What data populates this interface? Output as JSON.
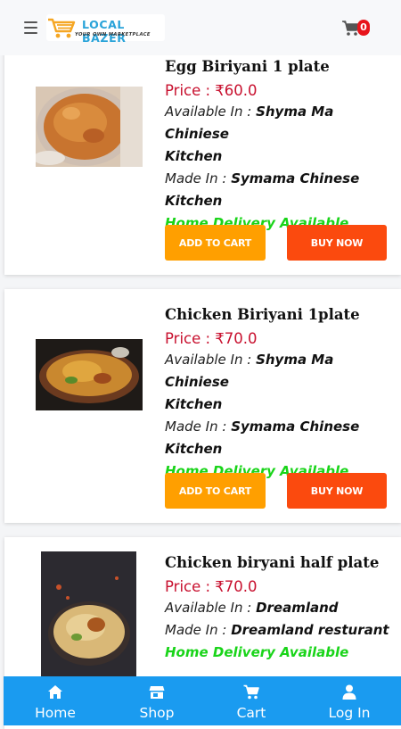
{
  "header": {
    "logo_text": "LOCAL BAZER",
    "logo_tagline": "YOUR OWN MARKETPLACE",
    "cart_count": "0"
  },
  "labels": {
    "available_in": "Available In :",
    "made_in": "Made In :"
  },
  "products": [
    {
      "title": "Egg Biriyani 1 plate",
      "price": "Price : ₹60.0",
      "available_line1": "Shyma Ma Chiniese",
      "available_line2": "Kitchen",
      "made_line1": "Symama Chinese",
      "made_line2": "Kitchen",
      "delivery": "Home Delivery Available",
      "add_to_cart": "ADD TO CART",
      "buy_now": "BUY NOW"
    },
    {
      "title": "Chicken Biriyani 1plate",
      "price": "Price : ₹70.0",
      "available_line1": "Shyma Ma Chiniese",
      "available_line2": "Kitchen",
      "made_line1": "Symama Chinese",
      "made_line2": "Kitchen",
      "delivery": "Home Delivery Available",
      "add_to_cart": "ADD TO CART",
      "buy_now": "BUY NOW"
    },
    {
      "title": "Chicken biryani half plate",
      "price": "Price : ₹70.0",
      "available_line1": "Dreamland",
      "made_line1": "Dreamland resturant",
      "delivery": "Home Delivery Available"
    }
  ],
  "bottom_nav": [
    {
      "label": "Home",
      "icon": "home-icon"
    },
    {
      "label": "Shop",
      "icon": "shop-icon"
    },
    {
      "label": "Cart",
      "icon": "cart-icon"
    },
    {
      "label": "Log In",
      "icon": "user-icon"
    }
  ],
  "colors": {
    "price": "#c8102e",
    "delivery": "#19d419",
    "add_to_cart": "#ff9f00",
    "buy_now": "#fb4a0e",
    "bottom_nav": "#1a9bf0",
    "badge": "#e8141b"
  }
}
